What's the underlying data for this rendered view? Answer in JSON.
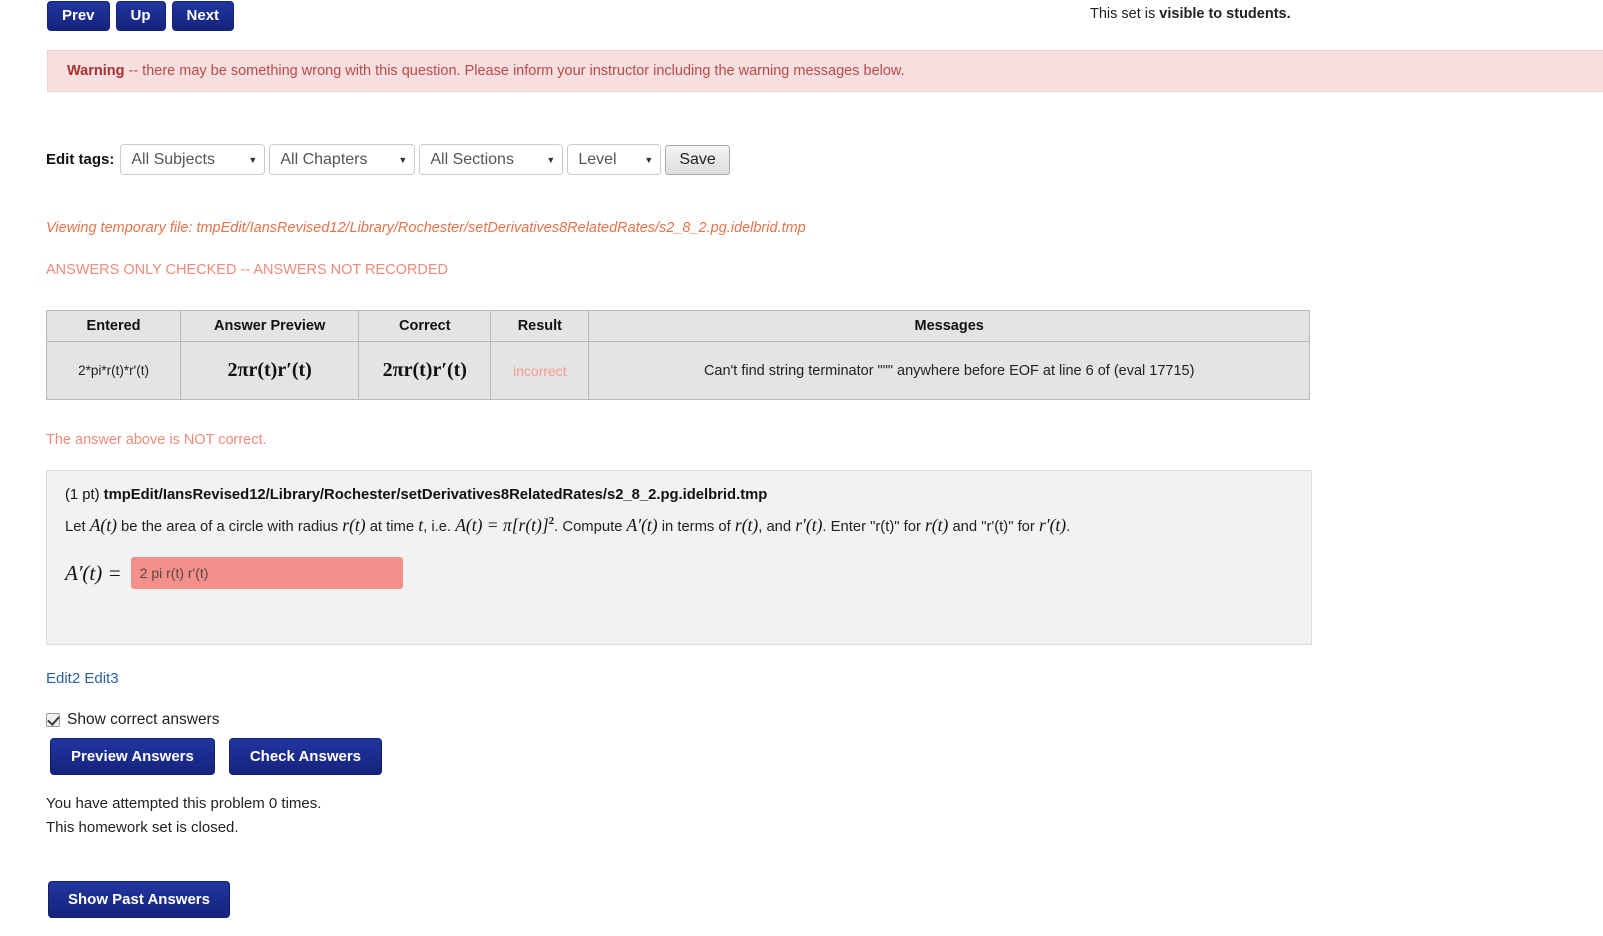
{
  "nav": {
    "prev_label": "Prev",
    "up_label": "Up",
    "next_label": "Next"
  },
  "status": {
    "visibility_prefix": "This set is ",
    "visibility_strong": "visible to students."
  },
  "warning": {
    "strong": "Warning",
    "text": " -- there may be something wrong with this question. Please inform your instructor including the warning messages below."
  },
  "edit_tags": {
    "label": "Edit tags:",
    "subject": "All Subjects",
    "chapter": "All Chapters",
    "section": "All Sections",
    "level": "Level",
    "save_label": "Save",
    "caret": "▼"
  },
  "temp_file_note": "Viewing temporary file: tmpEdit/IansRevised12/Library/Rochester/setDerivatives8RelatedRates/s2_8_2.pg.idelbrid.tmp",
  "checked_note": "ANSWERS ONLY CHECKED -- ANSWERS NOT RECORDED",
  "results": {
    "headers": [
      "Entered",
      "Answer Preview",
      "Correct",
      "Result",
      "Messages"
    ],
    "row": {
      "entered": "2*pi*r(t)*r'(t)",
      "preview_math": "2πr(t)r′(t)",
      "correct_math": "2πr(t)r′(t)",
      "result": "incorrect",
      "message": "Can't find string terminator \"\"\" anywhere before EOF at line 6 of (eval 17715)"
    }
  },
  "not_correct_note": "The answer above is NOT correct.",
  "problem": {
    "points": "(1 pt) ",
    "path": "tmpEdit/IansRevised12/Library/Rochester/setDerivatives8RelatedRates/s2_8_2.pg.idelbrid.tmp",
    "text_part1": "Let ",
    "math_At": "A(t)",
    "text_part2": " be the area of a circle with radius ",
    "math_rt": "r(t)",
    "text_part3": " at time ",
    "math_t": "t",
    "text_part4": ", i.e. ",
    "math_area_formula": "A(t) = π[r(t)]",
    "math_area_exponent": "2",
    "text_part5": ". Compute ",
    "math_Aprime": "A′(t)",
    "text_part6": " in terms of ",
    "math_rt2": "r(t)",
    "text_part7": ", and ",
    "math_rprime": "r′(t)",
    "text_part8": ". Enter \"r(t)\" for ",
    "math_rt3": "r(t)",
    "text_part9": " and \"r'(t)\" for ",
    "math_rprime2": "r′(t)",
    "text_part10": ".",
    "answer_label": "A′(t) =",
    "answer_value": "2 pi r(t) r'(t)"
  },
  "edit_links": {
    "edit2": "Edit2",
    "edit3": "Edit3"
  },
  "show_correct": {
    "label": "Show correct answers",
    "checked": true
  },
  "actions": {
    "preview_label": "Preview Answers",
    "check_label": "Check Answers"
  },
  "attempt_info": {
    "line1": "You have attempted this problem 0 times.",
    "line2": "This homework set is closed."
  },
  "past_answers": {
    "label": "Show Past Answers"
  },
  "colors": {
    "button_blue": "#1a2a8a",
    "warning_bg": "#f7dfe0",
    "warning_text": "#b94a48",
    "temp_file_orange": "#e8734a",
    "incorrect_salmon": "#f08a7a",
    "answer_field_pink": "#f4908b",
    "link_blue": "#2b5fa8",
    "table_bg": "#e4e4e4",
    "panel_bg": "#f2f2f2"
  }
}
